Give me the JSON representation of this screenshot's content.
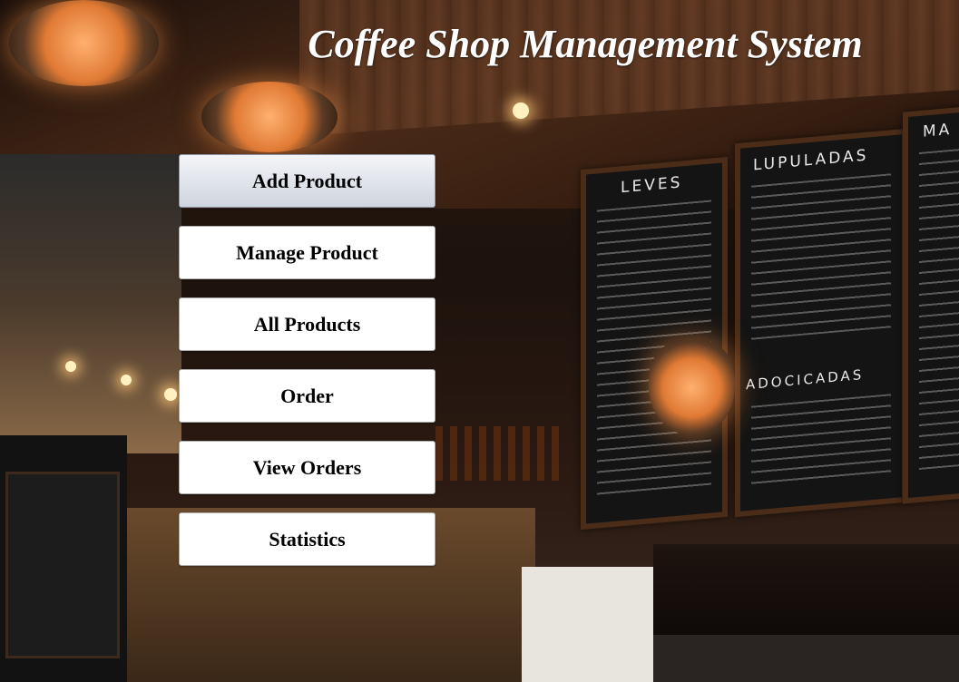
{
  "window": {
    "title": "Coffee Shop Management System"
  },
  "menu": {
    "items": [
      {
        "label": "Add Product",
        "selected": true
      },
      {
        "label": "Manage Product",
        "selected": false
      },
      {
        "label": "All Products",
        "selected": false
      },
      {
        "label": "Order",
        "selected": false
      },
      {
        "label": "View Orders",
        "selected": false
      },
      {
        "label": "Statistics",
        "selected": false
      }
    ]
  },
  "background": {
    "boards": {
      "left": "LEVES",
      "middle": "LUPULADAS",
      "middle_lower": "ADOCICADAS",
      "right": "MA"
    }
  }
}
